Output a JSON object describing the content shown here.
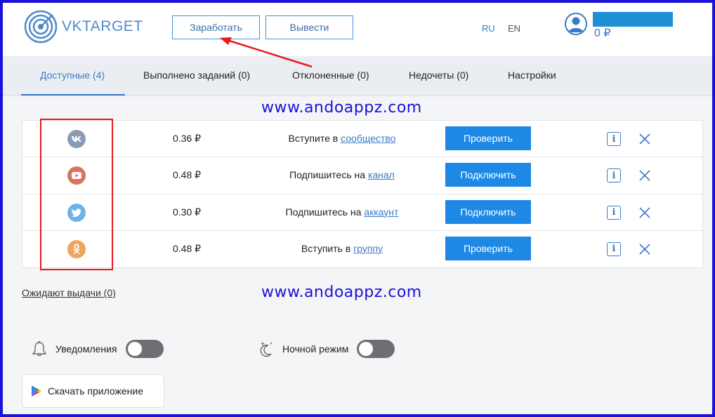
{
  "header": {
    "logo_text": "VKTARGET",
    "earn_label": "Заработать",
    "withdraw_label": "Вывести",
    "lang_ru": "RU",
    "lang_en": "EN",
    "balance": "0 ₽"
  },
  "tabs": [
    {
      "label": "Доступные (4)",
      "active": true
    },
    {
      "label": "Выполнено заданий (0)"
    },
    {
      "label": "Отклоненные (0)"
    },
    {
      "label": "Недочеты (0)"
    },
    {
      "label": "Настройки"
    }
  ],
  "watermark": "www.andoappz.com",
  "tasks": [
    {
      "service_icon": "vk-icon",
      "color": "#8a9bb5",
      "reward": "0.36 ₽",
      "text": "Вступите в ",
      "link": "сообщество",
      "action": "Проверить"
    },
    {
      "service_icon": "youtube-icon",
      "color": "#d9745c",
      "reward": "0.48 ₽",
      "text": "Подпишитесь на ",
      "link": "канал",
      "action": "Подключить"
    },
    {
      "service_icon": "twitter-icon",
      "color": "#6fb2e6",
      "reward": "0.30 ₽",
      "text": "Подпишитесь на ",
      "link": "аккаунт",
      "action": "Подключить"
    },
    {
      "service_icon": "odnoklassniki-icon",
      "color": "#f0a55a",
      "reward": "0.48 ₽",
      "text": "Вступить в ",
      "link": "группу",
      "action": "Проверить"
    }
  ],
  "info_glyph": "i",
  "pending_label": "Ожидают выдачи (0)",
  "settings": {
    "notifications_label": "Уведомления",
    "night_mode_label": "Ночной режим"
  },
  "download_label": "Скачать приложение",
  "colors": {
    "accent": "#3b7ac8",
    "button": "#1e88e5",
    "frame": "#1a12d8",
    "annotation": "#e8191e"
  }
}
